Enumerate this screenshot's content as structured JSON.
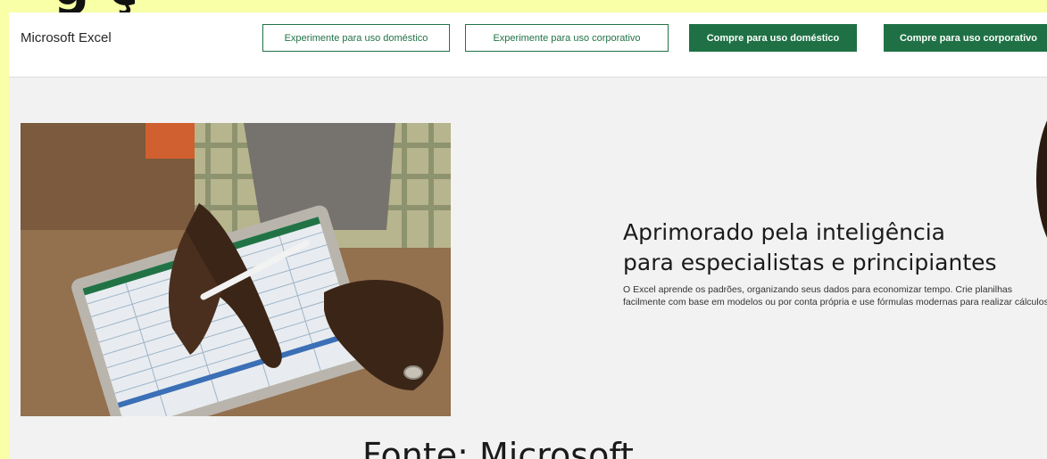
{
  "header": {
    "brand": "Microsoft Excel",
    "buttons": [
      {
        "label": "Experimente para uso doméstico",
        "style": "outline"
      },
      {
        "label": "Experimente para uso corporativo",
        "style": "outline"
      },
      {
        "label": "Compre para uso doméstico",
        "style": "solid"
      },
      {
        "label": "Compre para uso corporativo",
        "style": "solid"
      }
    ]
  },
  "hero": {
    "heading_line1": "Aprimorado pela inteligência",
    "heading_line2": "para especialistas e principiantes",
    "body": "O Excel aprende os padrões, organizando seus dados para economizar tempo. Crie planilhas facilmente com base em modelos ou por conta própria e use fórmulas modernas para realizar cálculos.",
    "image_subject": "hands-using-tablet-with-stylus"
  },
  "caption": "Fonte: Microsoft",
  "colors": {
    "background": "#f9ffa6",
    "page": "#f2f2f2",
    "accent_green": "#217346"
  }
}
